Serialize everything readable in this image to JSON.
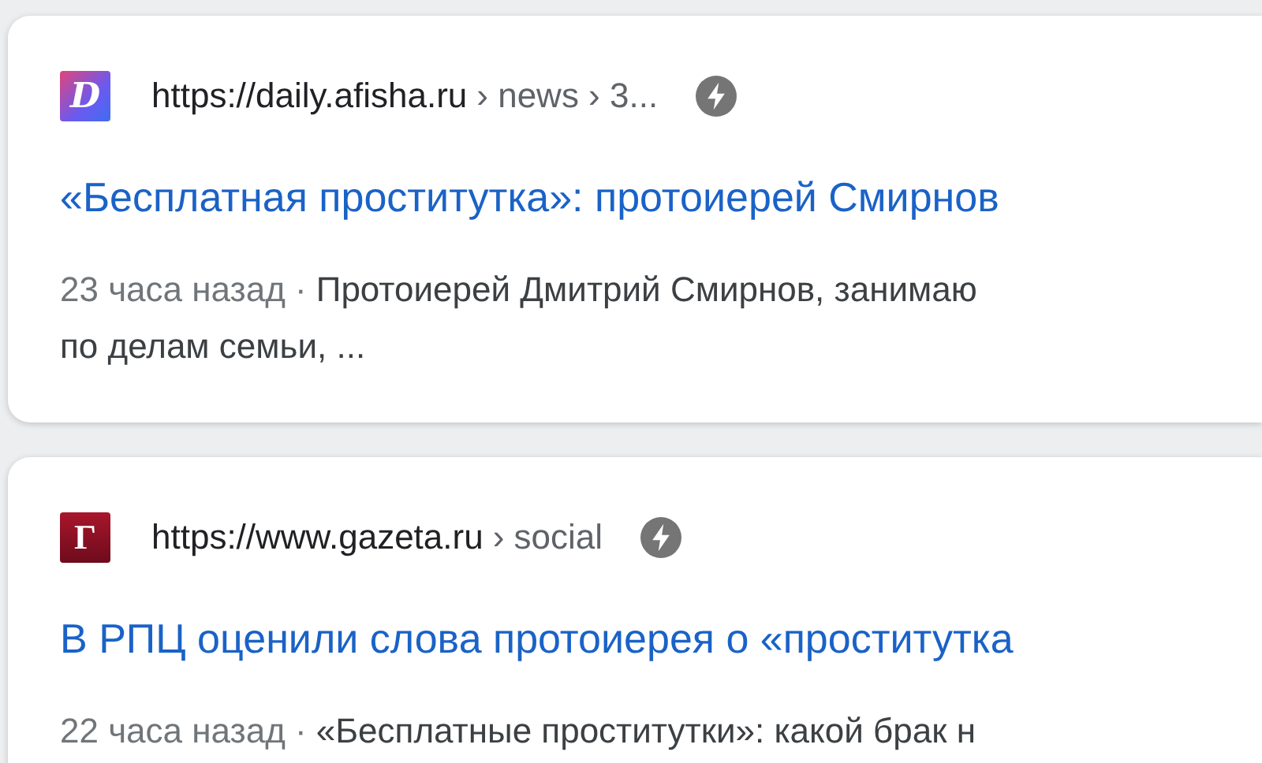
{
  "results": [
    {
      "favicon": {
        "letter": "D",
        "kind": "afisha"
      },
      "url": "https://daily.afisha.ru",
      "breadcrumb": "› news › 3...",
      "amp": true,
      "title": "«Бесплатная проститутка»: протоиерей Смирнов",
      "date": "23 часа назад ·",
      "snippet_lines": [
        "Протоиерей Дмитрий Смирнов, занимаю",
        "по делам семьи, ..."
      ]
    },
    {
      "favicon": {
        "letter": "Г",
        "kind": "gazeta"
      },
      "url": "https://www.gazeta.ru",
      "breadcrumb": "› social",
      "amp": true,
      "title": "В РПЦ оценили слова протоиерея о «проститутка",
      "date": "22 часа назад ·",
      "snippet_lines": [
        "«Бесплатные проститутки»: какой брак н"
      ]
    }
  ]
}
